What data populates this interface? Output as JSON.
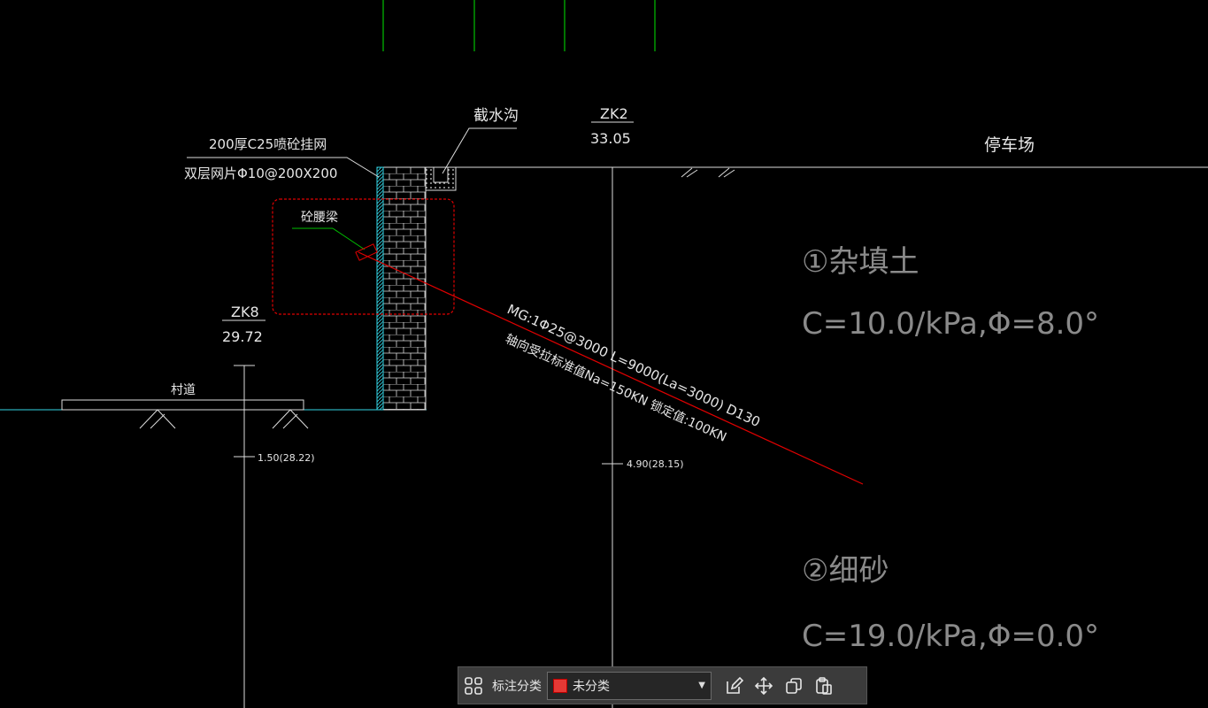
{
  "drawing": {
    "labels": {
      "shotcrete": "200厚C25喷砼挂网",
      "mesh": "双层网片Φ10@200X200",
      "waist_beam": "砼腰梁",
      "cutoff_ditch": "截水沟",
      "zk2_name": "ZK2",
      "zk2_elev": "33.05",
      "parking": "停车场",
      "zk8_name": "ZK8",
      "zk8_elev": "29.72",
      "village_road": "村道",
      "depth_zk8": "1.50(28.22)",
      "depth_zk2": "4.90(28.15)",
      "anchor_line1": "MG:1Φ25@3000  L=9000(La=3000) D130",
      "anchor_line2": "轴向受拉标准值Na=150KN   锁定值:100KN"
    },
    "layers": [
      {
        "name": "①杂填土",
        "params": "C=10.0/kPa,Φ=8.0°"
      },
      {
        "name": "②细砂",
        "params": "C=19.0/kPa,Φ=0.0°"
      }
    ],
    "colors": {
      "background": "#000000",
      "line": "#ffffff",
      "grid_green": "#00c000",
      "anchor_red": "#e00000",
      "wall_cyan": "#33d6e6",
      "layer_text": "#8a8a8a"
    }
  },
  "toolbar": {
    "grid_icon": "grid-icon",
    "label": "标注分类",
    "select_value": "未分类",
    "select_color": "#e53935",
    "buttons": [
      "edit-icon",
      "move-icon",
      "copy-icon",
      "paste-icon"
    ]
  }
}
